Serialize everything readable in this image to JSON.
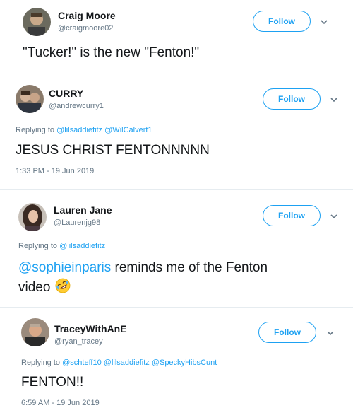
{
  "tweets": [
    {
      "name": "Craig Moore",
      "handle": "@craigmoore02",
      "follow_label": "Follow",
      "body": "\"Tucker!\" is the new \"Fenton!\""
    },
    {
      "name": "CURRY",
      "handle": "@andrewcurry1",
      "follow_label": "Follow",
      "reply_prefix": "Replying to",
      "reply_to": [
        "@lilsaddiefitz",
        "@WilCalvert1"
      ],
      "body": "JESUS CHRIST FENTONNNNN",
      "timestamp": "1:33 PM - 19 Jun 2019"
    },
    {
      "name": "Lauren Jane",
      "handle": "@Laurenjg98",
      "follow_label": "Follow",
      "reply_prefix": "Replying to",
      "reply_to": [
        "@lilsaddiefitz"
      ],
      "body_mention": "@sophieinparis",
      "body_rest": " reminds me of the Fenton",
      "body_line2": "video"
    },
    {
      "name": "TraceyWithAnE",
      "handle": "@ryan_tracey",
      "follow_label": "Follow",
      "reply_prefix": "Replying to",
      "reply_to": [
        "@schteff10",
        "@lilsaddiefitz",
        "@SpeckyHibsCunt"
      ],
      "body": "FENTON!!",
      "timestamp": "6:59 AM - 19 Jun 2019"
    }
  ],
  "colors": {
    "accent": "#1da1f2",
    "muted": "#657786",
    "text": "#14171a"
  },
  "icons": {
    "menu": "chevron-down-icon",
    "emoji": "rofl-emoji-icon"
  }
}
